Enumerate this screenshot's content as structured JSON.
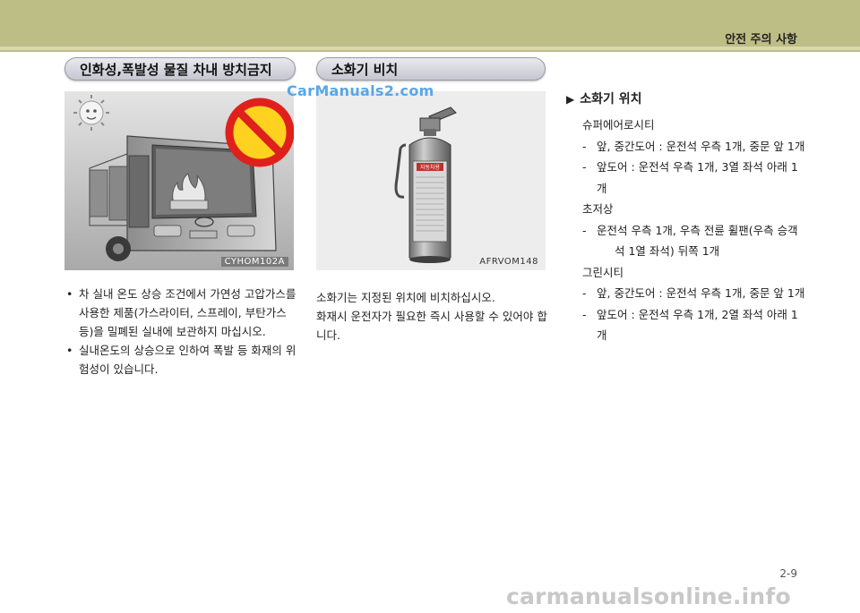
{
  "header": {
    "section_title": "안전 주의 사항"
  },
  "left_column": {
    "heading": "인화성,폭발성 물질 차내 방치금지",
    "image_code": "CYHOM102A",
    "bullets": [
      "차 실내 온도 상승 조건에서 가연성 고압가스를 사용한 제품(가스라이터, 스프레이, 부탄가스 등)을 밀폐된 실내에 보관하지 마십시오.",
      "실내온도의 상승으로 인하여 폭발 등 화재의 위험성이 있습니다."
    ]
  },
  "middle_column": {
    "heading": "소화기 비치",
    "image_code": "AFRVOM148",
    "extinguisher_label": "자동차용",
    "paragraph_lines": [
      "소화기는 지정된 위치에 비치하십시오.",
      "화재시 운전자가 필요한 즉시 사용할 수 있어야 합니다."
    ]
  },
  "right_column": {
    "title": "소화기 위치",
    "groups": [
      {
        "name": "슈퍼에어로시티",
        "items": [
          "앞, 중간도어 : 운전석 우측 1개, 중문 앞 1개",
          "앞도어 : 운전석 우측 1개, 3열 좌석 아래 1개"
        ]
      },
      {
        "name": "초저상",
        "items": [
          "운전석 우측 1개, 우측 전륜 휠팬(우측 승객",
          "석 1열 좌석) 뒤쪽 1개"
        ]
      },
      {
        "name": "그린시티",
        "items": [
          "앞, 중간도어 : 운전석 우측 1개, 중문 앞 1개",
          "앞도어 : 운전석 우측 1개, 2열 좌석 아래 1개"
        ]
      }
    ]
  },
  "page_number": "2-9",
  "watermarks": {
    "top": "CarManuals2.com",
    "bottom": "carmanualsonline.info"
  },
  "colors": {
    "header_band": "#bdbd86",
    "watermark_top": "#5aa6e8",
    "prohibition_red": "#e0201c",
    "prohibition_yellow": "#ffd21f"
  }
}
